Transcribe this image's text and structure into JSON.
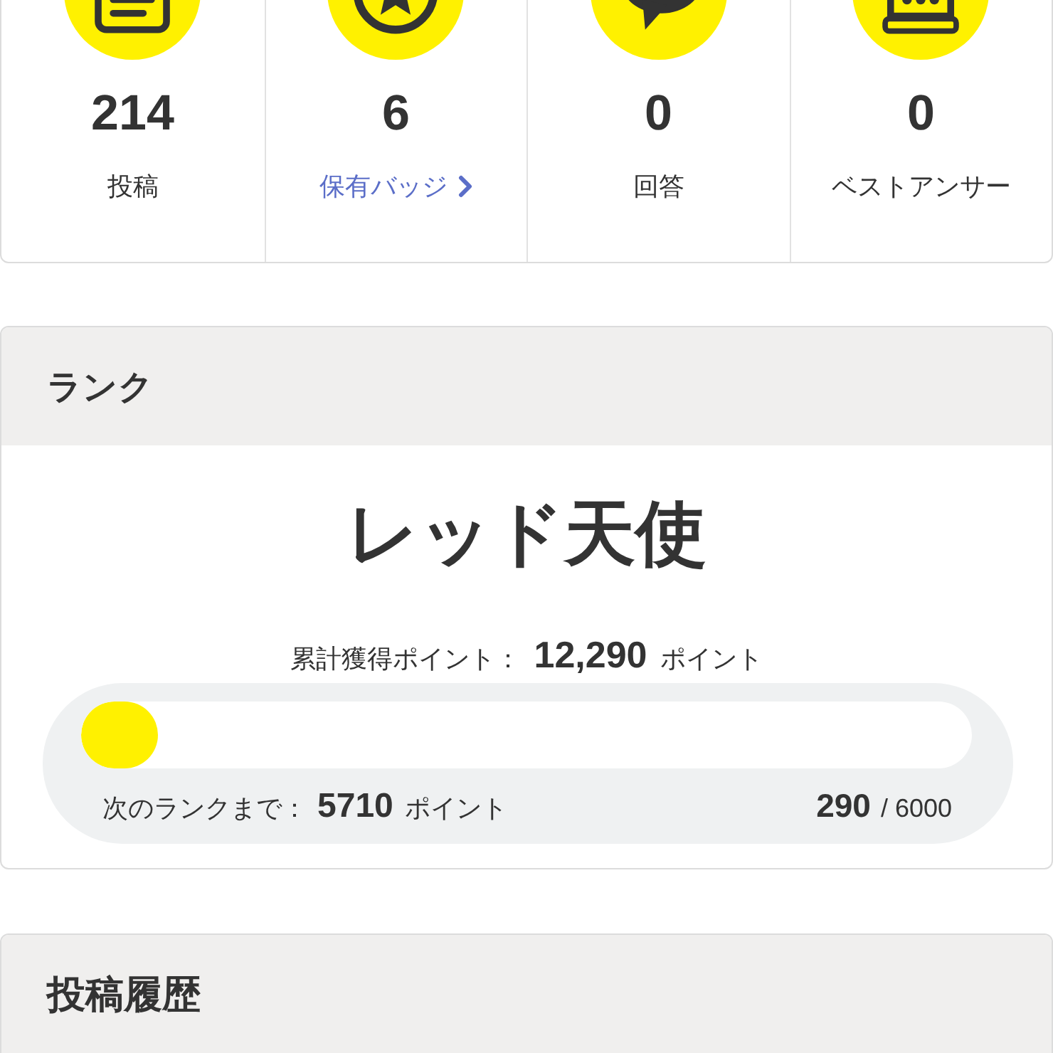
{
  "stats": [
    {
      "kind": "document",
      "value": "214",
      "label": "投稿",
      "link": false
    },
    {
      "kind": "badge",
      "value": "6",
      "label": "保有バッジ",
      "link": true
    },
    {
      "kind": "speech",
      "value": "0",
      "label": "回答",
      "link": false
    },
    {
      "kind": "crown",
      "value": "0",
      "label": "ベストアンサー",
      "link": false
    }
  ],
  "rank": {
    "title": "ランク",
    "name": "レッド天使",
    "total": "累計獲得ポイント： **12,290** ポイント",
    "progress": {
      "level": 0.048,
      "next": "次のランクまで： **5710** ポイント",
      "count": "**290** / 6000"
    }
  },
  "history": {
    "title": "投稿履歴"
  }
}
